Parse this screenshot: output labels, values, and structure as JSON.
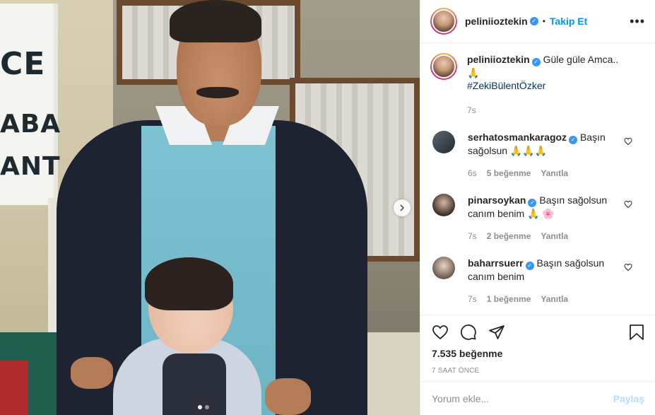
{
  "post": {
    "photo_sign": [
      "CE",
      "ABA",
      "ANT"
    ],
    "carousel_dots": [
      true,
      false
    ]
  },
  "header": {
    "username": "peliniioztekin",
    "separator": "•",
    "follow_label": "Takip Et",
    "more_icon": "more-horizontal-icon"
  },
  "caption": {
    "username": "peliniioztekin",
    "text": "Güle güle Amca.. 🙏",
    "hashtag": "#ZekiBülentÖzker",
    "time": "7s"
  },
  "comments": [
    {
      "username": "serhatosmankaragoz",
      "text": "Başın sağolsun 🙏🙏🙏",
      "time": "6s",
      "likes": "5 beğenme",
      "reply": "Yanıtla"
    },
    {
      "username": "pinarsoykan",
      "text": "Başın sağolsun canım benim 🙏 🌸",
      "time": "7s",
      "likes": "2 beğenme",
      "reply": "Yanıtla"
    },
    {
      "username": "baharrsuerr",
      "text": "Başın sağolsun canım benim",
      "time": "7s",
      "likes": "1 beğenme",
      "reply": "Yanıtla"
    }
  ],
  "actions": {
    "likes": "7.535 beğenme",
    "time": "7 SAAT ÖNCE"
  },
  "add_comment": {
    "placeholder": "Yorum ekle...",
    "share_label": "Paylaş"
  },
  "colors": {
    "link": "#0095f6",
    "verified": "#3897f0",
    "muted": "#8e8e8e",
    "hashtag": "#00376b"
  }
}
